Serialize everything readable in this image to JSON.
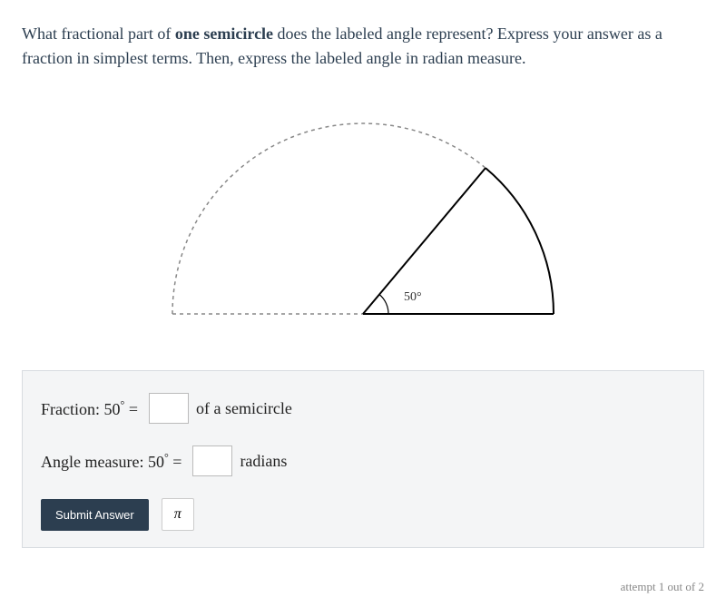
{
  "question": {
    "part1": "What fractional part of ",
    "bold": "one semicircle",
    "part2": " does the labeled angle represent? Express your answer as a fraction in simplest terms. Then, express the labeled angle in radian measure."
  },
  "diagram": {
    "angle_label": "50°",
    "angle_degrees": 50
  },
  "answers": {
    "fraction": {
      "prefix": "Fraction: 50",
      "degree": "°",
      "equals": " =",
      "suffix": "of a semicircle"
    },
    "angle_measure": {
      "prefix": "Angle measure: 50",
      "degree": "°",
      "equals": " =",
      "suffix": "radians"
    }
  },
  "buttons": {
    "submit": "Submit Answer",
    "pi": "π"
  },
  "footer": {
    "attempt": "attempt 1 out of 2"
  }
}
